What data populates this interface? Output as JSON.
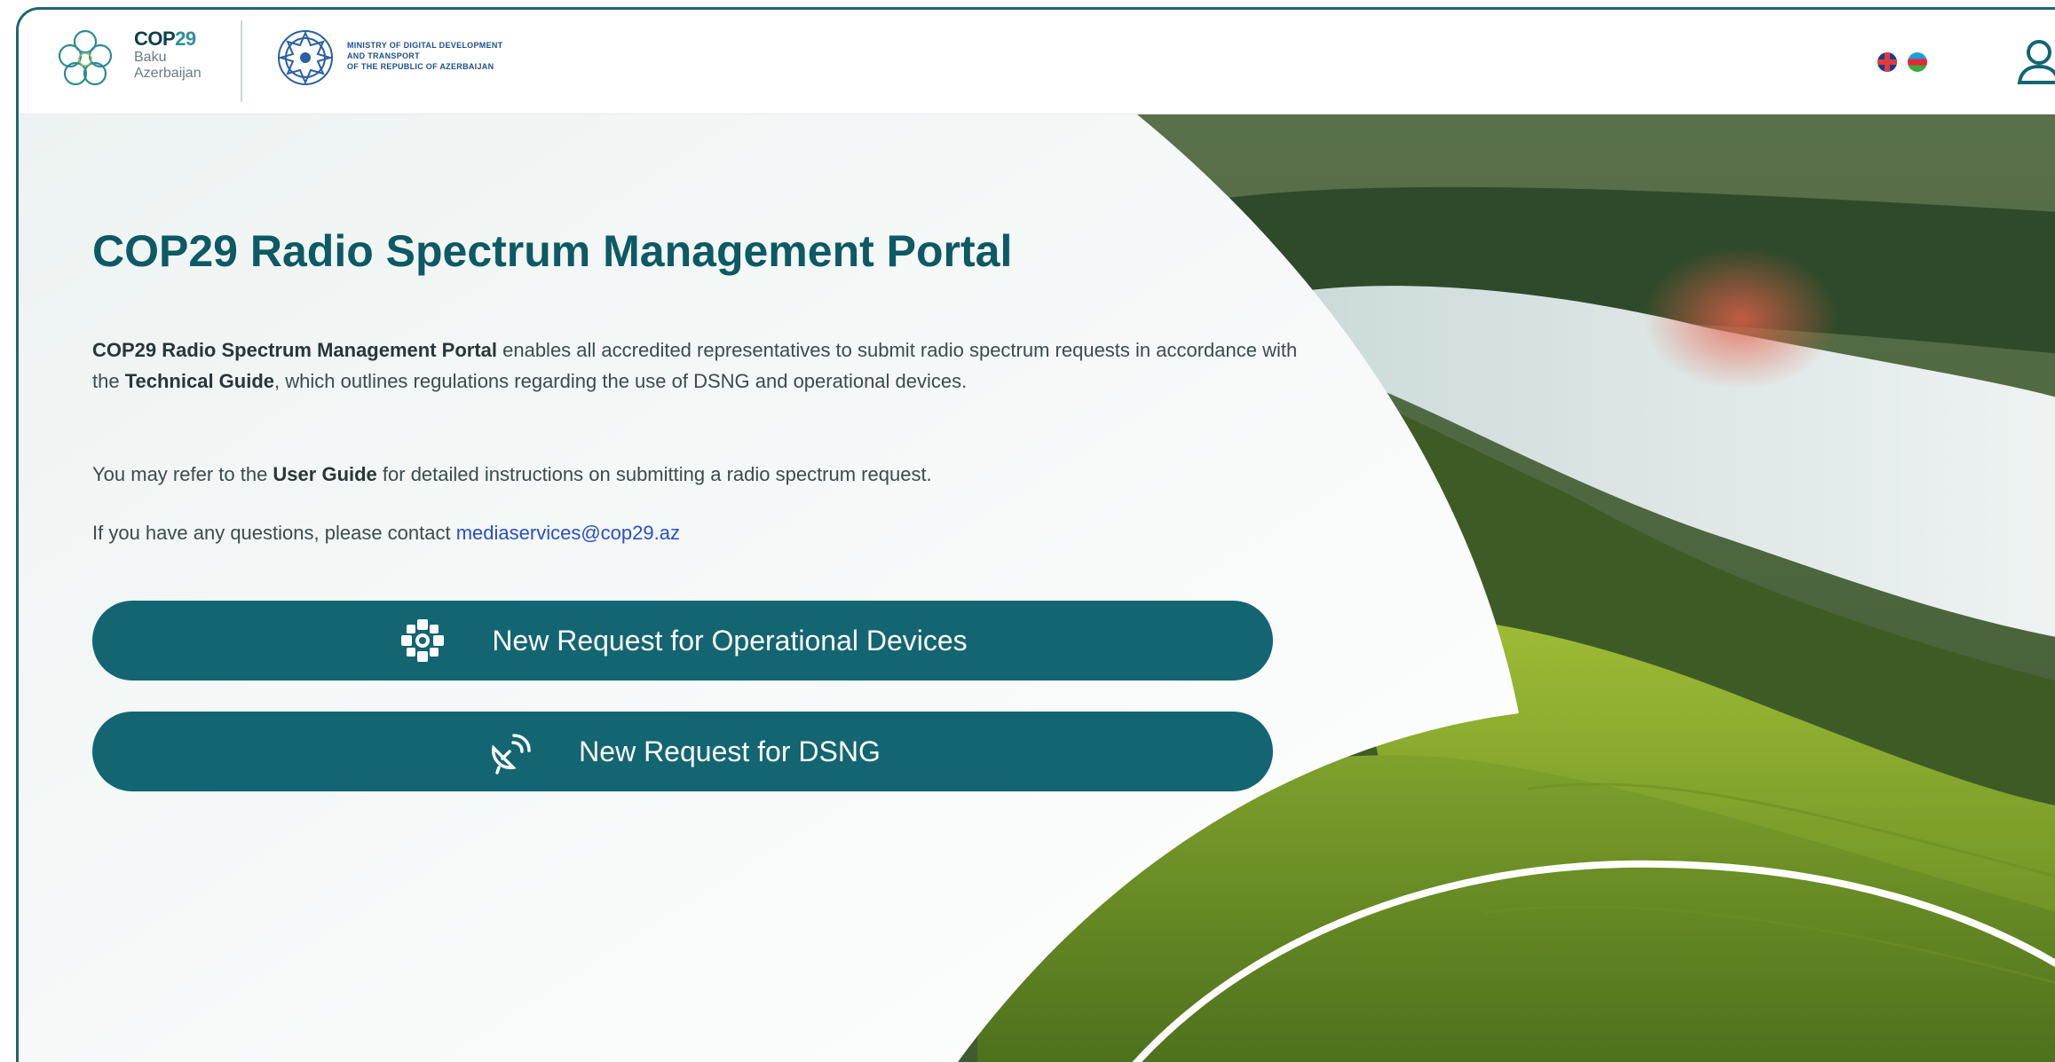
{
  "header": {
    "cop_title": "COP",
    "cop_title_num": "29",
    "cop_sub1": "Baku",
    "cop_sub2": "Azerbaijan",
    "ministry_line1": "MINISTRY OF DIGITAL DEVELOPMENT",
    "ministry_line2": "AND TRANSPORT",
    "ministry_line3": "OF THE REPUBLIC OF AZERBAIJAN",
    "languages": [
      "English",
      "Azerbaijani"
    ],
    "user_icon": "user-icon"
  },
  "main": {
    "title": "COP29 Radio Spectrum Management Portal",
    "intro": {
      "bold_1": "COP29 Radio Spectrum Management Portal",
      "text_1": " enables all accredited representatives to submit radio spectrum requests in accordance with the ",
      "bold_2": "Technical Guide",
      "text_2": ", which outlines regulations regarding the use of DSNG and operational devices."
    },
    "userguide": {
      "text_1": "You may refer to the ",
      "bold": "User Guide",
      "text_2": " for detailed instructions on submitting a radio spectrum request."
    },
    "contact": {
      "text": "If you have any questions, please contact ",
      "email": "mediaservices@cop29.az"
    },
    "buttons": [
      {
        "label": "New Request for Operational Devices",
        "icon": "operational-devices-icon"
      },
      {
        "label": "New Request for DSNG",
        "icon": "satellite-dish-icon"
      }
    ]
  },
  "colors": {
    "brand_teal": "#136571",
    "title_teal": "#0d5964",
    "link_blue": "#2a4fc2"
  }
}
